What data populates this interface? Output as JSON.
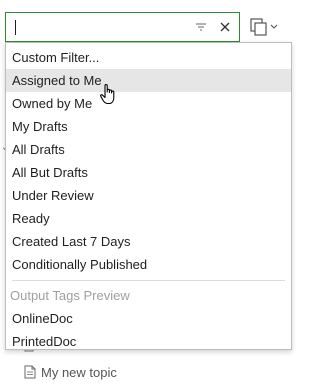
{
  "filter": {
    "value": "",
    "placeholder": ""
  },
  "icons": {
    "filter": "filter-lines-icon",
    "clear": "close-icon",
    "views": "copy-stack-icon",
    "dropdown_arrow": "chevron-down-icon",
    "cursor": "hand-pointer-icon"
  },
  "menu": {
    "items": [
      {
        "label": "Custom Filter..."
      },
      {
        "label": "Assigned to Me"
      },
      {
        "label": "Owned by Me"
      },
      {
        "label": "My Drafts"
      },
      {
        "label": "All Drafts"
      },
      {
        "label": "All But Drafts"
      },
      {
        "label": "Under Review"
      },
      {
        "label": "Ready"
      },
      {
        "label": "Created Last 7 Days"
      },
      {
        "label": "Conditionally Published"
      }
    ],
    "highlighted_index": 1,
    "section_header": "Output Tags Preview",
    "section_items": [
      {
        "label": "OnlineDoc"
      },
      {
        "label": "PrintedDoc"
      }
    ]
  },
  "background": {
    "topic_label": "My new topic"
  },
  "colors": {
    "focus_border": "#2e8b2e",
    "highlight": "#e6e6e6",
    "header_text": "#a0a0a0"
  }
}
